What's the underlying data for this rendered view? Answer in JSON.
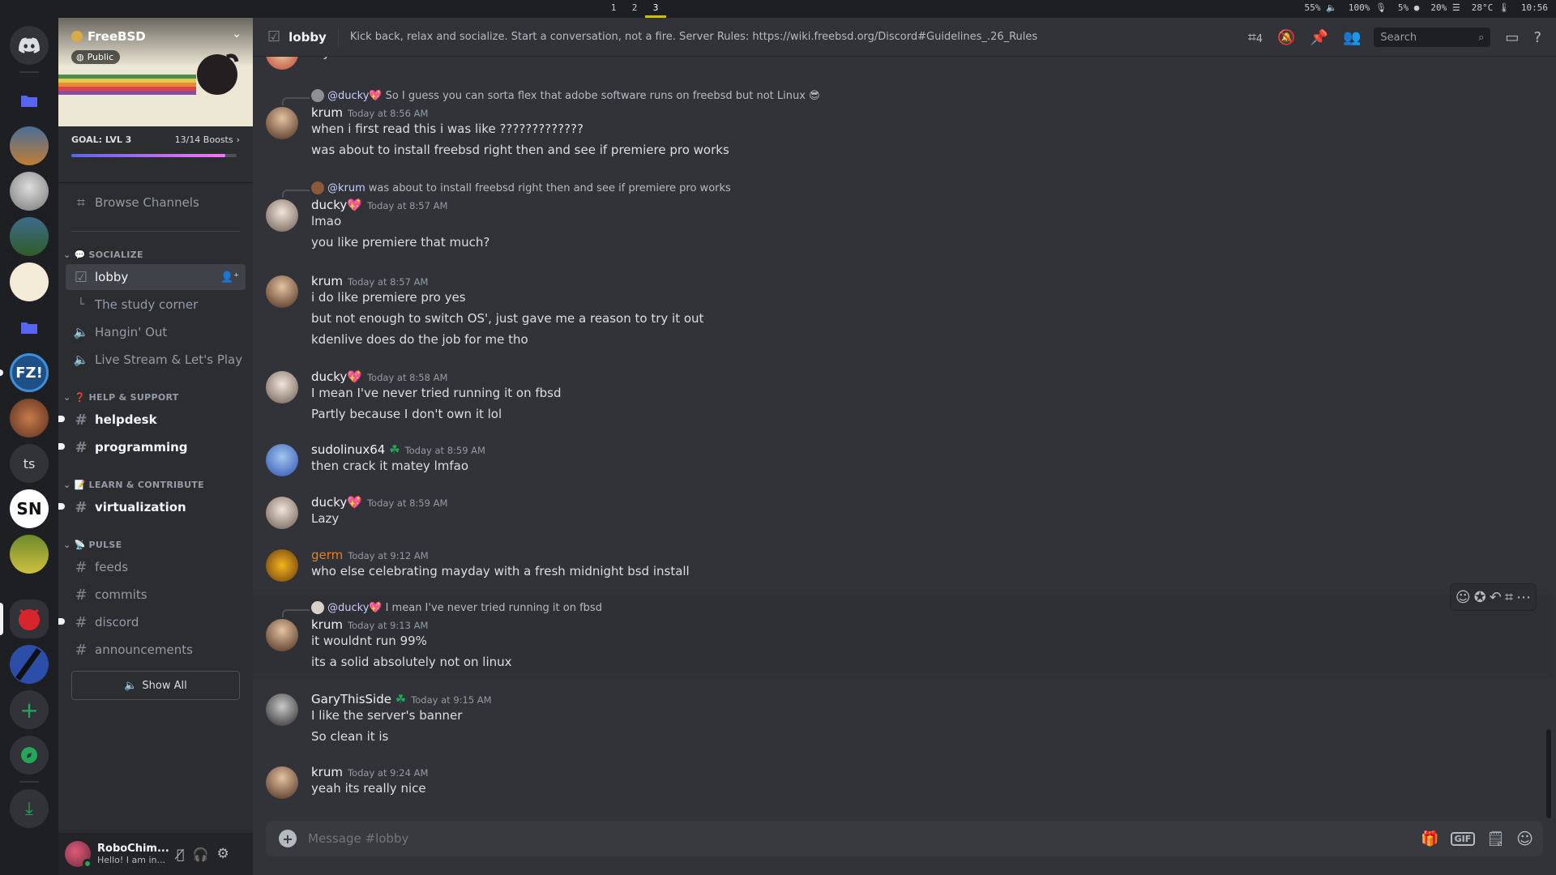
{
  "topbar": {
    "workspaces": [
      "1",
      "2",
      "3"
    ],
    "active_ws": "3",
    "cpu": "55%",
    "volume": "100%",
    "mic": "5%",
    "mem": "20%",
    "temp": "28°C",
    "time": "10:56"
  },
  "server": {
    "name": "FreeBSD",
    "public_label": "Public",
    "goal": "GOAL: LVL 3",
    "boosts": "13/14 Boosts",
    "boost_progress": 0.93
  },
  "nav": {
    "browse": "Browse Channels",
    "show_all": "Show All"
  },
  "categories": {
    "socialize": "SOCIALIZE",
    "help": "HELP & SUPPORT",
    "learn": "LEARN & CONTRIBUTE",
    "pulse": "PULSE"
  },
  "channels": {
    "lobby": "lobby",
    "study": "The study corner",
    "hangin": "Hangin' Out",
    "stream": "Live Stream & Let's Play",
    "helpdesk": "helpdesk",
    "programming": "programming",
    "virtualization": "virtualization",
    "feeds": "feeds",
    "commits": "commits",
    "discord": "discord",
    "announcements": "announcements"
  },
  "user": {
    "name": "RoboChim...",
    "status": "Hello! I am in..."
  },
  "header": {
    "channel": "lobby",
    "topic": "Kick back, relax and socialize. Start a conversation, not a fire. Server Rules: https://wiki.freebsd.org/Discord#Guidelines_.26_Rules",
    "threads_count": "4",
    "search_placeholder": "Search"
  },
  "composer": {
    "placeholder": "Message #lobby"
  },
  "guild_text": {
    "ts": "ts",
    "fz": "FZ!",
    "sn": "SN"
  },
  "messages": [
    {
      "lines": [
        "cry"
      ]
    },
    {
      "reply_user": "@ducky💖",
      "reply_text": "So I guess you can sorta flex that adobe software runs on freebsd but not Linux 😎",
      "user": "krum",
      "time": "Today at 8:56 AM",
      "lines": [
        "when i first read this i was like ?????????????",
        "was about to install freebsd right then and see if premiere pro works"
      ]
    },
    {
      "reply_user": "@krum",
      "reply_text": "was about to install freebsd right then and see if premiere pro works",
      "user": "ducky💖",
      "time": "Today at 8:57 AM",
      "lines": [
        "lmao",
        "you like premiere that much?"
      ]
    },
    {
      "user": "krum",
      "time": "Today at 8:57 AM",
      "lines": [
        "i do like premiere pro yes",
        "but not enough to switch OS', just gave me a reason to try it out",
        "kdenlive does do the job for me tho"
      ]
    },
    {
      "user": "ducky💖",
      "time": "Today at 8:58 AM",
      "lines": [
        "I mean I've never tried running it on fbsd",
        "Partly because I don't own it lol"
      ]
    },
    {
      "user": "sudolinux64",
      "time": "Today at 8:59 AM",
      "lines": [
        "then crack it matey lmfao"
      ]
    },
    {
      "user": "ducky💖",
      "time": "Today at 8:59 AM",
      "lines": [
        "Lazy"
      ]
    },
    {
      "user": "germ",
      "time": "Today at 9:12 AM",
      "lines": [
        "who else celebrating mayday with a fresh midnight bsd install"
      ]
    },
    {
      "reply_user": "@ducky💖",
      "reply_text": "I mean I've never tried running it on fbsd",
      "user": "krum",
      "time": "Today at 9:13 AM",
      "lines": [
        "it wouldnt run 99%",
        "its a solid absolutely not on linux"
      ]
    },
    {
      "user": "GaryThisSide",
      "time": "Today at 9:15 AM",
      "lines": [
        "I like the server's banner",
        "So clean it is"
      ]
    },
    {
      "user": "krum",
      "time": "Today at 9:24 AM",
      "lines": [
        "yeah its really nice"
      ]
    }
  ],
  "colors": {
    "bg": "#313338",
    "sidebar": "#2b2d31",
    "rail": "#1e1f22",
    "accent": "#5865f2",
    "germ": "#e67e22",
    "online": "#23a55a"
  }
}
